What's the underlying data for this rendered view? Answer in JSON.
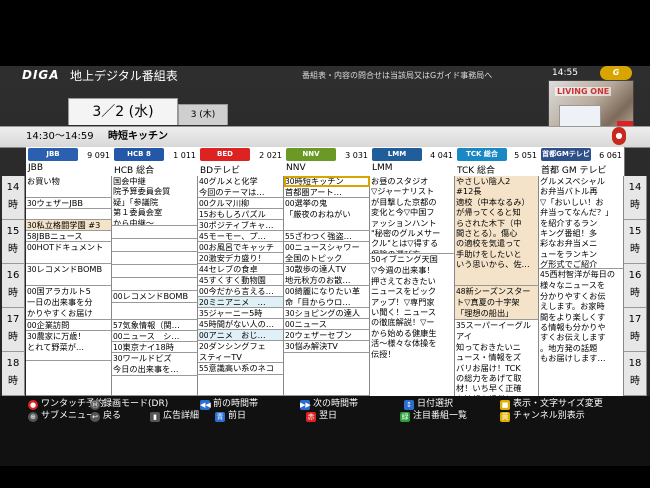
{
  "header": {
    "brand": "DIGA",
    "title": "地上デジタル番組表",
    "notice": "番組表・内容の問合せは当該局又はGガイド事務局へ",
    "clock": "14:55",
    "gguide_badge": "G GUIDE",
    "preview_label": "LIVING ONE"
  },
  "dates": {
    "selected": "3／2 (水)",
    "next": "3 (木)"
  },
  "current_program": {
    "time": "14:30～14:59",
    "name": "時短キッチン"
  },
  "channels": [
    {
      "logo": "JBB",
      "number": "9 091",
      "name": "JBB",
      "logo_color": "#2b5fb0"
    },
    {
      "logo": "HCB 8",
      "number": "1 011",
      "name": "HCB 総合",
      "logo_color": "#2557a8"
    },
    {
      "logo": "BED",
      "number": "2 021",
      "name": "BDテレビ",
      "logo_color": "#d22"
    },
    {
      "logo": "NNV",
      "number": "3 031",
      "name": "NNV",
      "logo_color": "#6a9a25"
    },
    {
      "logo": "LMM",
      "number": "4 041",
      "name": "LMM",
      "logo_color": "#1f5e9a"
    },
    {
      "logo": "TCK 総合",
      "number": "5 051",
      "name": "TCK 総合",
      "logo_color": "#1a88c4"
    },
    {
      "logo": "首都GMテレビ",
      "number": "6 061",
      "name": "首都 GM テレビ",
      "logo_color": "#2d4f8a"
    }
  ],
  "hours": [
    "14",
    "15",
    "16",
    "17",
    "18"
  ],
  "hour_suffix": "時",
  "programs": [
    [
      {
        "t": "",
        "text": "お買い物"
      },
      {
        "t": "30",
        "text": "ウェザーJBB"
      },
      {
        "t": "",
        "text": ""
      },
      {
        "t": "30",
        "text": "私立格闘学園 #3"
      },
      {
        "t": "58",
        "text": "JBBニュース"
      },
      {
        "t": "00",
        "text": "HOTドキュメント"
      },
      {
        "t": "30",
        "text": "レコメンドBOMB"
      },
      {
        "t": "00",
        "text": "国アラカルト5\n一日の出来事を分\nかりやすくお届け\nお出掛けも充実"
      },
      {
        "t": "00",
        "text": "企業訪問"
      },
      {
        "t": "30",
        "text": "農家に万歳！\nとれて野菜が…"
      }
    ],
    [
      {
        "t": "",
        "text": "国会中継\n院予算委員会質\n疑」「参議院\n第１委員会室\nから中継～"
      },
      {
        "t": "",
        "text": ""
      },
      {
        "t": "",
        "text": ""
      },
      {
        "t": "",
        "text": ""
      },
      {
        "t": "",
        "text": ""
      },
      {
        "t": "",
        "text": ""
      },
      {
        "t": "00",
        "text": "レコメンドBOMB"
      },
      {
        "t": "",
        "text": ""
      },
      {
        "t": "57",
        "text": "気象情報（関…"
      },
      {
        "t": "00",
        "text": "ニュース　シ…"
      },
      {
        "t": "10",
        "text": "東京ナイ18時"
      },
      {
        "t": "30",
        "text": "ワールドビズ\n今日の出来事を…"
      }
    ],
    [
      {
        "t": "40",
        "text": "グルメと化学\n今回のテーマは…"
      },
      {
        "t": "00",
        "text": "クルマ川柳"
      },
      {
        "t": "15",
        "text": "おもしろパズル"
      },
      {
        "t": "30",
        "text": "ポジティブキャ…"
      },
      {
        "t": "45",
        "text": "モーモー、プ…"
      },
      {
        "t": "00",
        "text": "お風呂でキャッチ"
      },
      {
        "t": "20",
        "text": "激安デカ盛り！"
      },
      {
        "t": "44",
        "text": "セレブの食卓"
      },
      {
        "t": "45",
        "text": "すくすく動物園"
      },
      {
        "t": "00",
        "text": "今だから言える…"
      },
      {
        "t": "20",
        "text": "ミニアニメ　…"
      },
      {
        "t": "35",
        "text": "ジャーニー5時"
      },
      {
        "t": "45",
        "text": "時間がない人の…"
      },
      {
        "t": "00",
        "text": "アニメ　おじ…"
      },
      {
        "t": "20",
        "text": "ダンシングフェ\nスティーTV"
      },
      {
        "t": "55",
        "text": "意識高い系のネコ"
      }
    ],
    [
      {
        "t": "30",
        "text": "時短キッチン"
      },
      {
        "t": "",
        "text": "首都圏アート…"
      },
      {
        "t": "00",
        "text": "選挙の鬼\n「厳夜のおねがい"
      },
      {
        "t": "55",
        "text": "ざわつく強盗…"
      },
      {
        "t": "00",
        "text": "ニュースシャワー\n全国のトピック"
      },
      {
        "t": "30",
        "text": "散歩の達人TV\n地元秋方のお散…"
      },
      {
        "t": "00",
        "text": "綺麗になりたい革\n命「目からウロ…"
      },
      {
        "t": "30",
        "text": "ショピングの達人"
      },
      {
        "t": "00",
        "text": "ニュース"
      },
      {
        "t": "20",
        "text": "ウェザーセブン"
      },
      {
        "t": "30",
        "text": "悩み解決TV"
      }
    ],
    [
      {
        "t": "",
        "text": "お昼のスタジオ\n▽ジャーナリスト\nが目撃した京都の\n変化と今▽中国フ\nァッションハント\n\"秘密のグルメサー\nクル\"とは▽得する\n保険の選び方"
      },
      {
        "t": "50",
        "text": "イブニング天国\n▽今週の出来事！\n押さえておきたい\nニュースをピック\nアップ！▽専門家\nい聞く！ニュース\nの徹底解説！▽ー\nから始める健康生\n活～様々な体操を\n伝授！"
      }
    ],
    [
      {
        "t": "",
        "text": "やさしい陰人2\n#12長\n適校（中本なるみ）\nが帰ってくると知\nらされた木下（中\n間さとる）。傷心\nの適校を気遣って\n手助けをしたいと\nいう思いから、佐…"
      },
      {
        "t": "48",
        "text": "新シーズンスター\nト▽真夏の十字架\n「理想の船出」"
      },
      {
        "t": "35",
        "text": "スーパーイーグル\nアイ\n知っておきたいニ\nュース・情報をズ\nバリお届け！TCK\nの総力をあげて取\n材！いち早く正確\nな情報を提供して\nいきます"
      }
    ],
    [
      {
        "t": "",
        "text": "グルメスペシャル\nお弁当バトル再\n▽「おいしい！お\n弁当ってなんだ？」\nを紹介するラン\nキング番組！多\n彩なお弁当メニ\nューをランキン\nグ形式でご紹介\nしていきます"
      },
      {
        "t": "45",
        "text": "西村智洋が毎日の\n様々なニュースを\n分かりやすくお伝\nえします。お家時\n間をより楽しくす\nる情報も分かりや\nすくお伝えします\n。地方発の話題\nもお届けします…"
      }
    ]
  ],
  "footer": {
    "row1": [
      {
        "icon": "red",
        "label": "ワンタッチ予約"
      },
      {
        "icon": "mode",
        "label": "録画モード(DR)"
      },
      {
        "icon": "prev",
        "label": "前の時間帯"
      },
      {
        "icon": "next",
        "label": "次の時間帯"
      },
      {
        "icon": "select",
        "label": "日付選択"
      },
      {
        "icon": "yellow",
        "label": "表示・文字サイズ変更"
      }
    ],
    "row2": [
      {
        "icon": "sub",
        "label": "サブメニュー"
      },
      {
        "icon": "back",
        "label": "戻る"
      },
      {
        "icon": "ad",
        "label": "広告詳細"
      },
      {
        "icon": "blue",
        "label": "前日"
      },
      {
        "icon": "red2",
        "label": "翌日"
      },
      {
        "icon": "green",
        "label": "注目番組一覧"
      },
      {
        "icon": "yellow2",
        "label": "チャンネル別表示"
      }
    ]
  }
}
